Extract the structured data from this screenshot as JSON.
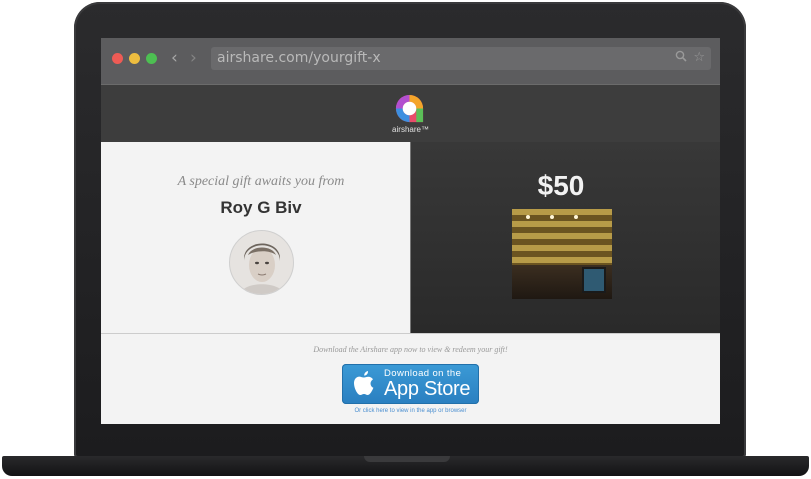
{
  "browser": {
    "url": "airshare.com/yourgift-x",
    "back_icon": "chevron-left-icon",
    "forward_icon": "chevron-right-icon",
    "search_icon": "search-icon",
    "bookmark_icon": "star-icon",
    "traffic_lights": {
      "close": "#ee5b55",
      "minimize": "#eebd3f",
      "zoom": "#4dbf52"
    }
  },
  "header": {
    "logo_text": "airshare™"
  },
  "gift": {
    "intro": "A special gift awaits you from",
    "sender_name": "Roy G Biv",
    "amount": "$50"
  },
  "download": {
    "note": "Download the Airshare app now to view & redeem your gift!",
    "button_line1": "Download on the",
    "button_line2": "App Store",
    "alt_link": "Or click here to view in the app or browser"
  },
  "colors": {
    "accent_blue": "#2f86c8",
    "header_bg": "#3d3d3d",
    "panel_light": "#f3f3f3"
  }
}
